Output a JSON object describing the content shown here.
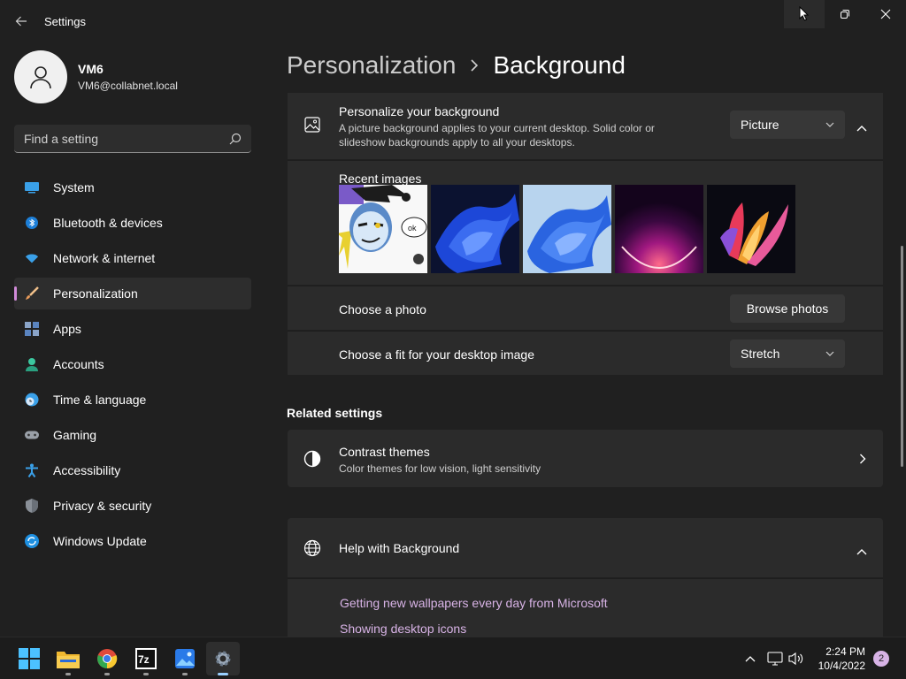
{
  "window": {
    "title": "Settings"
  },
  "profile": {
    "name": "VM6",
    "email": "VM6@collabnet.local"
  },
  "search": {
    "placeholder": "Find a setting"
  },
  "sidebar": {
    "items": [
      {
        "label": "System",
        "icon": "system-icon",
        "active": false
      },
      {
        "label": "Bluetooth & devices",
        "icon": "bluetooth-icon",
        "active": false
      },
      {
        "label": "Network & internet",
        "icon": "wifi-icon",
        "active": false
      },
      {
        "label": "Personalization",
        "icon": "brush-icon",
        "active": true
      },
      {
        "label": "Apps",
        "icon": "apps-icon",
        "active": false
      },
      {
        "label": "Accounts",
        "icon": "person-icon",
        "active": false
      },
      {
        "label": "Time & language",
        "icon": "clock-globe-icon",
        "active": false
      },
      {
        "label": "Gaming",
        "icon": "gamepad-icon",
        "active": false
      },
      {
        "label": "Accessibility",
        "icon": "accessibility-icon",
        "active": false
      },
      {
        "label": "Privacy & security",
        "icon": "shield-icon",
        "active": false
      },
      {
        "label": "Windows Update",
        "icon": "update-icon",
        "active": false
      }
    ]
  },
  "breadcrumb": {
    "parent": "Personalization",
    "current": "Background"
  },
  "background": {
    "title": "Personalize your background",
    "description_line1": "A picture background applies to your current desktop. Solid color or",
    "description_line2": "slideshow backgrounds apply to all your desktops.",
    "dropdown_value": "Picture",
    "recent_label": "Recent images",
    "choose_photo_label": "Choose a photo",
    "browse_button": "Browse photos",
    "fit_label": "Choose a fit for your desktop image",
    "fit_value": "Stretch"
  },
  "related": {
    "title": "Related settings",
    "contrast_title": "Contrast themes",
    "contrast_desc": "Color themes for low vision, light sensitivity"
  },
  "help": {
    "title": "Help with Background",
    "links": [
      "Getting new wallpapers every day from Microsoft",
      "Showing desktop icons"
    ]
  },
  "taskbar": {
    "time": "2:24 PM",
    "date": "10/4/2022",
    "notifications": "2"
  },
  "colors": {
    "accent": "#d08ad8",
    "link": "#d8b3e6",
    "background": "#202020",
    "card": "#2b2b2b"
  }
}
